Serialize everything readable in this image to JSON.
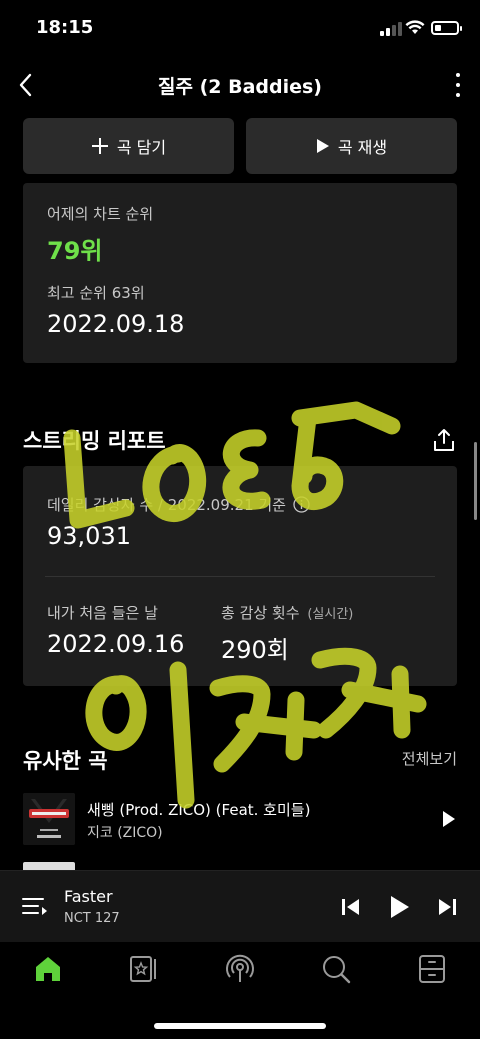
{
  "status_bar": {
    "time": "18:15"
  },
  "header": {
    "title": "질주 (2 Baddies)"
  },
  "actions": {
    "add_label": "곡 담기",
    "play_label": "곡 재생"
  },
  "chart_card": {
    "yesterday_label": "어제의 차트 순위",
    "yesterday_rank": "79위",
    "best_label": "최고 순위 63위",
    "best_date": "2022.09.18"
  },
  "streaming": {
    "title": "스트리밍 리포트",
    "daily_label": "데일리 감상자 수 / 2022.09.21 기준",
    "daily_value": "93,031",
    "first_label": "내가 처음 들은 날",
    "first_value": "2022.09.16",
    "total_label": "총 감상 횟수",
    "total_suffix": "(실시간)",
    "total_value": "290회"
  },
  "similar": {
    "title": "유사한 곡",
    "see_all": "전체보기",
    "tracks": [
      {
        "title": "새삥 (Prod. ZICO) (Feat. 호미들)",
        "artist": "지코 (ZICO)"
      }
    ]
  },
  "now_playing": {
    "title": "Faster",
    "artist": "NCT 127"
  },
  "battery_level": 0.3,
  "colors": {
    "accent": "#6fe04a",
    "card": "#1e1e1e",
    "button": "#2b2b2b",
    "scribble": "#c7d22a"
  },
  "icons": [
    "back-icon",
    "more-icon",
    "plus-icon",
    "play-icon",
    "share-icon",
    "info-icon",
    "queue-icon",
    "previous-icon",
    "next-icon",
    "home-icon",
    "library-icon",
    "podcast-icon",
    "search-icon",
    "storage-icon"
  ]
}
